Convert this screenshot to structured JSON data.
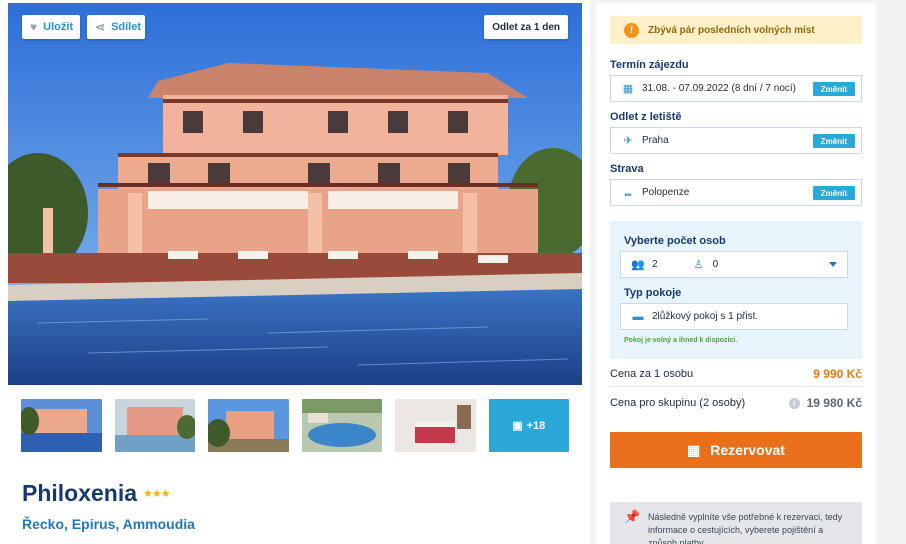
{
  "hero": {
    "save_label": "Uložit",
    "share_label": "Sdílet",
    "depart_badge": "Odlet za 1 den"
  },
  "thumbnails": {
    "more_label": "+18"
  },
  "hotel": {
    "name": "Philoxenia",
    "stars": "★★★",
    "location": "Řecko, Epirus, Ammoudia"
  },
  "booking": {
    "alert_text": "Zbývá pár posledních volných míst",
    "term_label": "Termín zájezdu",
    "term_value": "31.08. - 07.09.2022 (8 dní / 7 nocí)",
    "airport_label": "Odlet z letiště",
    "airport_value": "Praha",
    "board_label": "Strava",
    "board_value": "Polopenze",
    "change_label": "Změnit",
    "persons_label": "Vyberte počet osob",
    "adults": "2",
    "children": "0",
    "room_label": "Typ pokoje",
    "room_value": "2lůžkový pokoj s 1 přist.",
    "room_note": "Pokoj je volný a ihned k dispozici.",
    "price_one_label": "Cena za 1 osobu",
    "price_one_value": "9 990 Kč",
    "price_group_label": "Cena pro skupinu (2 osoby)",
    "price_group_value": "19 980 Kč",
    "book_label": "Rezervovat",
    "note_text": "Následně vyplníte vše potřebné k rezervaci, tedy informace o cestujících, vyberete pojištění a způsob platby."
  },
  "colors": {
    "accent": "#2aa8da",
    "cta": "#e8701a",
    "title": "#173a6e"
  }
}
